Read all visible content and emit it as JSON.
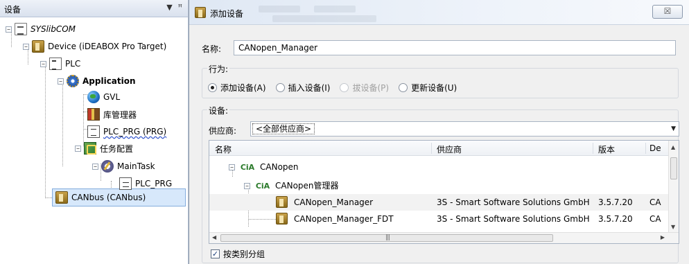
{
  "tree_panel": {
    "title": "设备",
    "pin_label": "▼ ᵖ",
    "nodes": [
      {
        "label": "SYSlibCOM",
        "icon": "project-icon"
      },
      {
        "label": "Device (iDEABOX Pro Target)",
        "icon": "device-icon"
      },
      {
        "label": "PLC",
        "icon": "plc-icon"
      },
      {
        "label": "Application",
        "icon": "application-icon"
      },
      {
        "label": "GVL",
        "icon": "gvl-globe-icon"
      },
      {
        "label": "库管理器",
        "icon": "library-manager-icon"
      },
      {
        "label": "PLC_PRG (PRG)",
        "icon": "pou-icon"
      },
      {
        "label": "任务配置",
        "icon": "task-config-icon"
      },
      {
        "label": "MainTask",
        "icon": "maintask-icon"
      },
      {
        "label": "PLC_PRG",
        "icon": "program-call-icon"
      },
      {
        "label": "CANbus (CANbus)",
        "icon": "canbus-device-icon"
      }
    ]
  },
  "dialog": {
    "title": "添加设备",
    "close_label": "☒",
    "name_label": "名称:",
    "name_value": "CANopen_Manager",
    "behavior_label": "行为:",
    "radios": [
      {
        "label": "添加设备(A)",
        "checked": true,
        "disabled": false
      },
      {
        "label": "插入设备(I)",
        "checked": false,
        "disabled": false
      },
      {
        "label": "拔设备(P)",
        "checked": false,
        "disabled": true
      },
      {
        "label": "更新设备(U)",
        "checked": false,
        "disabled": false
      }
    ],
    "device_label": "设备:",
    "vendor_label": "供应商:",
    "vendor_value": "<全部供应商>",
    "table": {
      "headers": [
        "名称",
        "供应商",
        "版本",
        "De"
      ],
      "rows": [
        {
          "name": "CANopen",
          "vendor": "",
          "version": "",
          "desc": ""
        },
        {
          "name": "CANopen管理器",
          "vendor": "",
          "version": "",
          "desc": ""
        },
        {
          "name": "CANopen_Manager",
          "vendor": "3S - Smart Software Solutions GmbH",
          "version": "3.5.7.20",
          "desc": "CA"
        },
        {
          "name": "CANopen_Manager_FDT",
          "vendor": "3S - Smart Software Solutions GmbH",
          "version": "3.5.7.20",
          "desc": "CA"
        }
      ],
      "cia_logo": "CiA"
    },
    "group_by_category_label": "按类别分组",
    "group_by_category_checked": true
  },
  "colors": {
    "selection_bg": "#d7e8fb",
    "dialog_bg": "#f0f0f0",
    "title_gradient_start": "#dfe8f4"
  }
}
